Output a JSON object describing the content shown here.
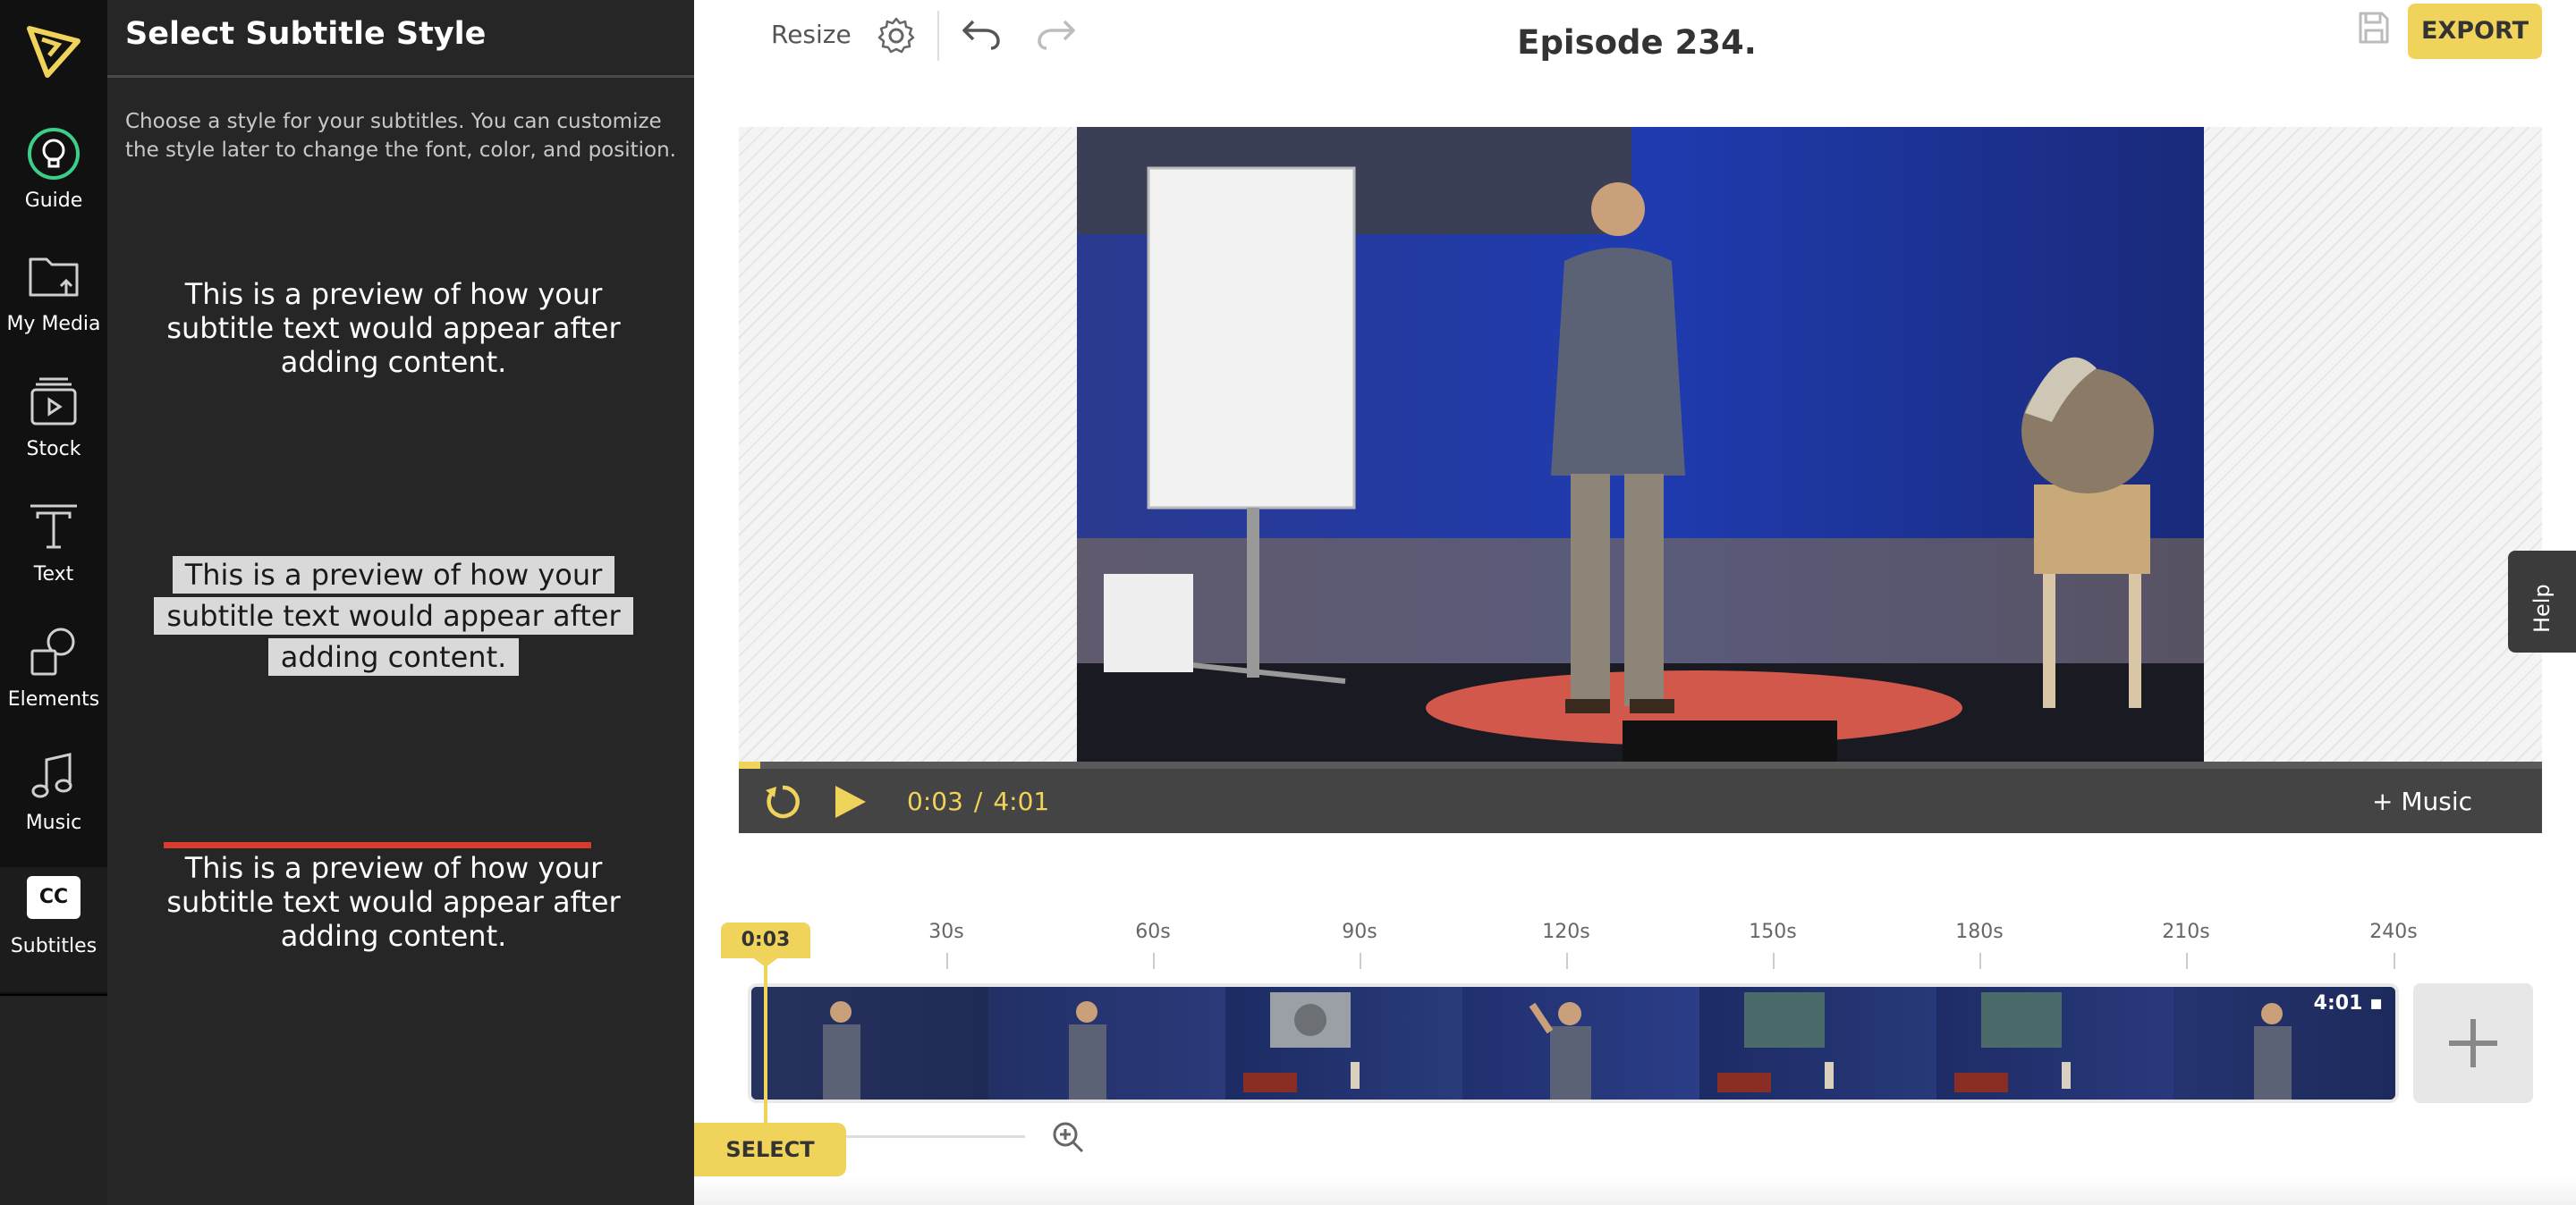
{
  "sidebar": {
    "items": [
      {
        "label": "Guide",
        "icon": "lightbulb-icon"
      },
      {
        "label": "My Media",
        "icon": "folder-upload-icon"
      },
      {
        "label": "Stock",
        "icon": "stock-video-icon"
      },
      {
        "label": "Text",
        "icon": "text-icon"
      },
      {
        "label": "Elements",
        "icon": "shapes-icon"
      },
      {
        "label": "Music",
        "icon": "music-note-icon"
      },
      {
        "label": "Subtitles",
        "icon": "cc-icon",
        "badge": "CC",
        "active": true
      }
    ]
  },
  "panel": {
    "title": "Select Subtitle Style",
    "description": "Choose a style for your subtitles. You can customize the style later to change the font, color, and position.",
    "previews": [
      {
        "lines": [
          "This is a preview of how your",
          "subtitle text would appear after",
          "adding content."
        ]
      },
      {
        "lines": [
          "This is a preview of how your",
          "subtitle text would appear after",
          "adding content."
        ]
      },
      {
        "lines": [
          "This is a preview of how your",
          "subtitle text would appear after",
          "adding content."
        ]
      }
    ]
  },
  "toolbar": {
    "resize_label": "Resize",
    "episode_title": "Episode 234.",
    "export_label": "EXPORT"
  },
  "player": {
    "current_time": "0:03",
    "separator": "/",
    "duration": "4:01",
    "music_label": "+ Music",
    "progress": 0.012
  },
  "help": {
    "label": "Help"
  },
  "timeline": {
    "playhead_label": "0:03",
    "ticks": [
      "30s",
      "60s",
      "90s",
      "120s",
      "150s",
      "180s",
      "210s",
      "240s"
    ],
    "clip_duration": "4:01",
    "add_clip_label": "+",
    "select_label": "SELECT"
  },
  "colors": {
    "accent": "#f0d35a",
    "rail": "#111111",
    "panel": "#262626",
    "controls": "#444444",
    "subtitle_bar": "#d93a2b"
  }
}
